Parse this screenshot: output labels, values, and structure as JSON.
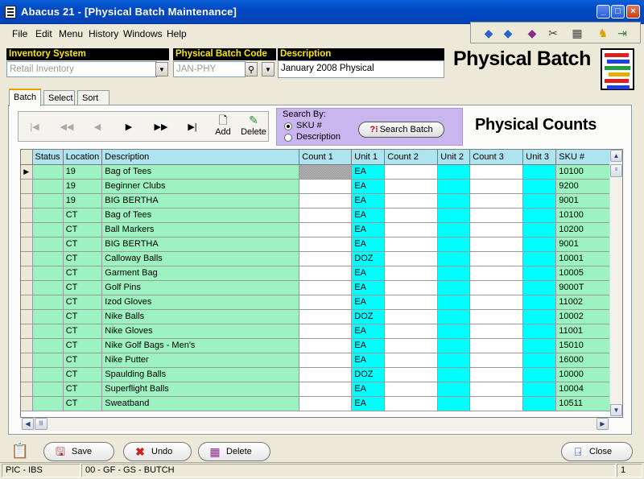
{
  "window": {
    "title": "Abacus 21 - [Physical Batch Maintenance]"
  },
  "menu": [
    "File",
    "Edit",
    "Menu",
    "History",
    "Windows",
    "Help"
  ],
  "header": {
    "inventory_system_label": "Inventory System",
    "inventory_system_value": "Retail Inventory",
    "batch_code_label": "Physical Batch Code",
    "batch_code_value": "JAN-PHY",
    "description_label": "Description",
    "description_value": "January 2008 Physical",
    "big_title": "Physical Batch"
  },
  "tabs": [
    "Batch",
    "Select",
    "Sort"
  ],
  "toolbar": {
    "add_label": "Add",
    "delete_label": "Delete"
  },
  "search": {
    "label": "Search By:",
    "options": [
      "SKU #",
      "Description"
    ],
    "selected": "SKU #",
    "button_label": "Search Batch"
  },
  "section_title": "Physical Counts",
  "grid": {
    "columns": [
      "Status",
      "Location",
      "Description",
      "Count 1",
      "Unit 1",
      "Count 2",
      "Unit 2",
      "Count 3",
      "Unit 3",
      "SKU #"
    ],
    "rows": [
      {
        "location": "19",
        "description": "Bag of Tees",
        "unit": "EA",
        "sku": "10100"
      },
      {
        "location": "19",
        "description": "Beginner Clubs",
        "unit": "EA",
        "sku": "9200"
      },
      {
        "location": "19",
        "description": "BIG BERTHA",
        "unit": "EA",
        "sku": "9001"
      },
      {
        "location": "CT",
        "description": "Bag of Tees",
        "unit": "EA",
        "sku": "10100"
      },
      {
        "location": "CT",
        "description": "Ball Markers",
        "unit": "EA",
        "sku": "10200"
      },
      {
        "location": "CT",
        "description": "BIG BERTHA",
        "unit": "EA",
        "sku": "9001"
      },
      {
        "location": "CT",
        "description": "Calloway Balls",
        "unit": "DOZ",
        "sku": "10001"
      },
      {
        "location": "CT",
        "description": "Garment Bag",
        "unit": "EA",
        "sku": "10005"
      },
      {
        "location": "CT",
        "description": "Golf Pins",
        "unit": "EA",
        "sku": "9000T"
      },
      {
        "location": "CT",
        "description": "Izod Gloves",
        "unit": "EA",
        "sku": "11002"
      },
      {
        "location": "CT",
        "description": "Nike Balls",
        "unit": "DOZ",
        "sku": "10002"
      },
      {
        "location": "CT",
        "description": "Nike Gloves",
        "unit": "EA",
        "sku": "11001"
      },
      {
        "location": "CT",
        "description": "Nike Golf Bags - Men's",
        "unit": "EA",
        "sku": "15010"
      },
      {
        "location": "CT",
        "description": "Nike Putter",
        "unit": "EA",
        "sku": "16000"
      },
      {
        "location": "CT",
        "description": "Spaulding Balls",
        "unit": "DOZ",
        "sku": "10000"
      },
      {
        "location": "CT",
        "description": "Superflight Balls",
        "unit": "EA",
        "sku": "10004"
      },
      {
        "location": "CT",
        "description": "Sweatband",
        "unit": "EA",
        "sku": "10511"
      }
    ]
  },
  "buttons": {
    "save": "Save",
    "undo": "Undo",
    "delete": "Delete",
    "close": "Close"
  },
  "statusbar": {
    "left": "PIC - IBS",
    "middle": "00 - GF - GS - BUTCH",
    "right": "1"
  },
  "colors": {
    "grid_green": "#9df2c2",
    "grid_cyan": "#00ffff",
    "header_blue": "#aee3f0",
    "label_yellow": "#f7e600",
    "search_purple": "#c9b6ef"
  }
}
